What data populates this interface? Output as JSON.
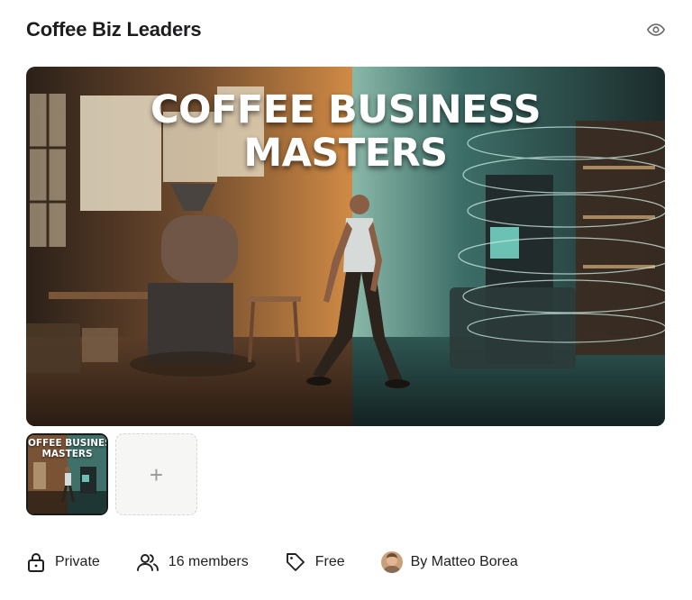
{
  "header": {
    "title": "Coffee Biz Leaders",
    "visibility_icon": "eye-icon"
  },
  "hero": {
    "title_line1": "COFFEE BUSINESS",
    "title_line2": "MASTERS"
  },
  "thumbnails": [
    {
      "text_line1": "OFFEE BUSINES",
      "text_line2": "MASTERS",
      "selected": true
    }
  ],
  "add_thumbnail": {
    "symbol": "+"
  },
  "meta": {
    "privacy": {
      "icon": "lock-icon",
      "label": "Private"
    },
    "members": {
      "icon": "users-icon",
      "label": "16 members"
    },
    "price": {
      "icon": "tag-icon",
      "label": "Free"
    },
    "owner": {
      "icon": "avatar",
      "label": "By Matteo Borea"
    }
  },
  "colors": {
    "warm": "#c27a3b",
    "teal": "#3e7f79",
    "text": "#1f1f1f"
  }
}
